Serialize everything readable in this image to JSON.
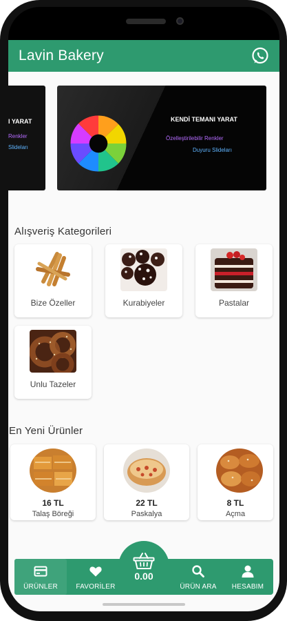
{
  "app": {
    "title": "Lavin Bakery",
    "whatsapp_icon": "whatsapp-icon",
    "brand_color": "#2e9a6f"
  },
  "banner": {
    "main": {
      "headline": "KENDİ TEMANI YARAT",
      "line1": "Özelleştirilebilir Renkler",
      "line2": "Duyuru Slideları"
    },
    "prev": {
      "headline": "I YARAT",
      "line1": "Renkler",
      "line2": "Slideları"
    }
  },
  "categories": {
    "title": "Alışveriş Kategorileri",
    "items": [
      {
        "label": "Bize Özeller",
        "icon": "breadsticks-image"
      },
      {
        "label": "Kurabiyeler",
        "icon": "cookies-image"
      },
      {
        "label": "Pastalar",
        "icon": "cake-image"
      },
      {
        "label": "Unlu Tazeler",
        "icon": "simit-image"
      }
    ]
  },
  "products": {
    "title": "En Yeni Ürünler",
    "items": [
      {
        "price": "16 TL",
        "name": "Talaş Böreği"
      },
      {
        "price": "22 TL",
        "name": "Paskalya"
      },
      {
        "price": "8 TL",
        "name": "Açma"
      }
    ]
  },
  "nav": {
    "items": [
      {
        "label": "ÜRÜNLER",
        "icon": "products-icon",
        "active": true
      },
      {
        "label": "FAVORİLER",
        "icon": "heart-icon",
        "active": false
      },
      {
        "label": "ÜRÜN ARA",
        "icon": "search-icon",
        "active": false
      },
      {
        "label": "HESABIM",
        "icon": "account-icon",
        "active": false
      }
    ],
    "cart": {
      "total": "0.00",
      "icon": "basket-icon"
    }
  }
}
